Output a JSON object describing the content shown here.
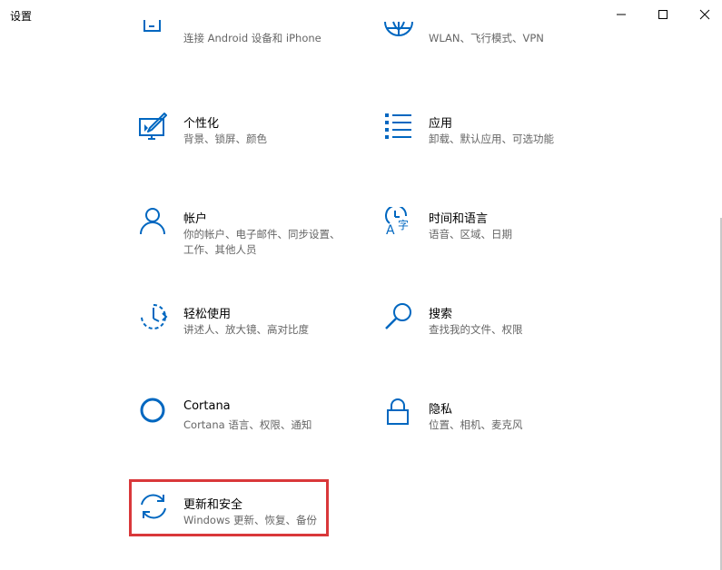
{
  "window": {
    "title": "设置",
    "controls": {
      "minimize": "minimize-icon",
      "maximize": "maximize-icon",
      "close": "close-icon"
    }
  },
  "accent": "#0067c0",
  "tiles": [
    {
      "icon": "phone-icon",
      "name": "",
      "desc": "连接 Android 设备和 iPhone"
    },
    {
      "icon": "globe-icon",
      "name": "",
      "desc": "WLAN、飞行模式、VPN"
    },
    {
      "icon": "personalization-icon",
      "name": "个性化",
      "desc": "背景、锁屏、颜色"
    },
    {
      "icon": "apps-list-icon",
      "name": "应用",
      "desc": "卸载、默认应用、可选功能"
    },
    {
      "icon": "person-icon",
      "name": "帐户",
      "desc": "你的帐户、电子邮件、同步设置、工作、其他人员"
    },
    {
      "icon": "time-language-icon",
      "name": "时间和语言",
      "desc": "语音、区域、日期"
    },
    {
      "icon": "ease-of-access-icon",
      "name": "轻松使用",
      "desc": "讲述人、放大镜、高对比度"
    },
    {
      "icon": "search-icon",
      "name": "搜索",
      "desc": "查找我的文件、权限"
    },
    {
      "icon": "cortana-icon",
      "name": "Cortana",
      "desc": "Cortana 语言、权限、通知"
    },
    {
      "icon": "lock-icon",
      "name": "隐私",
      "desc": "位置、相机、麦克风"
    },
    {
      "icon": "update-icon",
      "name": "更新和安全",
      "desc": "Windows 更新、恢复、备份"
    }
  ]
}
